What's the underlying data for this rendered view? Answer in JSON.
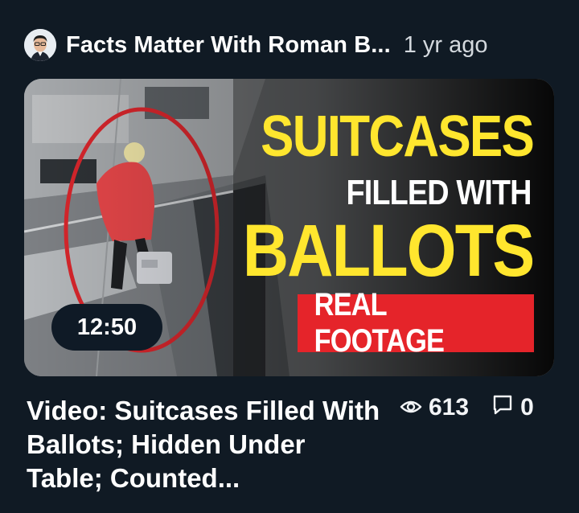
{
  "card": {
    "channel_name": "Facts Matter With Roman B...",
    "posted_ago": "1 yr ago",
    "thumbnail": {
      "headline_line1": "SUITCASES",
      "headline_line2": "FILLED WITH",
      "headline_line3": "BALLOTS",
      "banner_text": "REAL FOOTAGE",
      "duration": "12:50",
      "colors": {
        "headline_yellow": "#ffe62e",
        "banner_red": "#e5242a",
        "circle_red": "#d8262c"
      }
    },
    "title": "Video: Suitcases Filled With Ballots; Hidden Under Table; Counted...",
    "views": "613",
    "comments": "0",
    "icons": {
      "views": "eye-icon",
      "comments": "comment-icon"
    }
  },
  "theme": {
    "background": "#101a24",
    "text": "#ffffff",
    "muted": "#d4d9de"
  }
}
